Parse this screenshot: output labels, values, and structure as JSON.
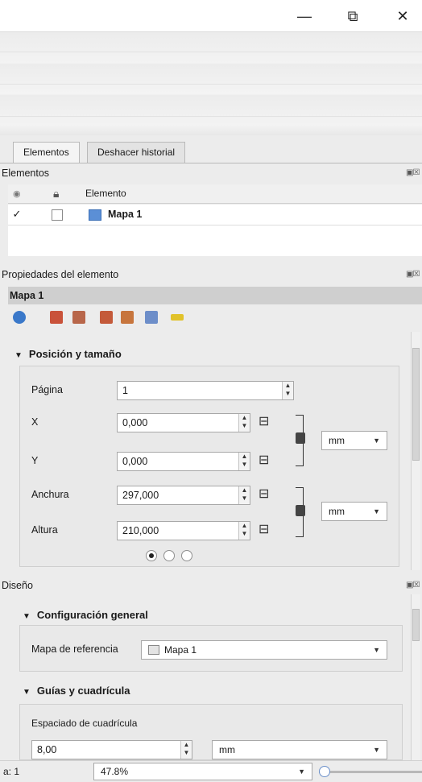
{
  "window": {
    "minimize": "—",
    "restore": "⧉",
    "close": "✕"
  },
  "tabs": [
    {
      "label": "Elementos",
      "active": true
    },
    {
      "label": "Deshacer historial",
      "active": false
    }
  ],
  "items_panel": {
    "title": "Elementos",
    "header": {
      "element_col": "Elemento"
    },
    "rows": [
      {
        "visible": true,
        "locked": false,
        "name": "Mapa 1"
      }
    ]
  },
  "properties_panel": {
    "title": "Propiedades del elemento",
    "item_name": "Mapa 1",
    "position_group": {
      "title": "Posición y tamaño",
      "page_label": "Página",
      "page_value": "1",
      "x_label": "X",
      "x_value": "0,000",
      "y_label": "Y",
      "y_value": "0,000",
      "width_label": "Anchura",
      "width_value": "297,000",
      "height_label": "Altura",
      "height_value": "210,000",
      "pos_unit": "mm",
      "size_unit": "mm",
      "reference_point_selected": 0
    }
  },
  "design_panel": {
    "title": "Diseño",
    "general_group": {
      "title": "Configuración general",
      "reference_map_label": "Mapa de referencia",
      "reference_map_value": "Mapa 1"
    },
    "grid_group": {
      "title": "Guías y cuadrícula",
      "grid_spacing_label": "Espaciado de cuadrícula",
      "grid_spacing_value": "8,00",
      "grid_spacing_unit": "mm"
    }
  },
  "statusbar": {
    "page_text": "a: 1",
    "zoom": "47.8%"
  },
  "colors": {
    "accent": "#4a7bc8",
    "panel_header": "#cfcfcf"
  }
}
